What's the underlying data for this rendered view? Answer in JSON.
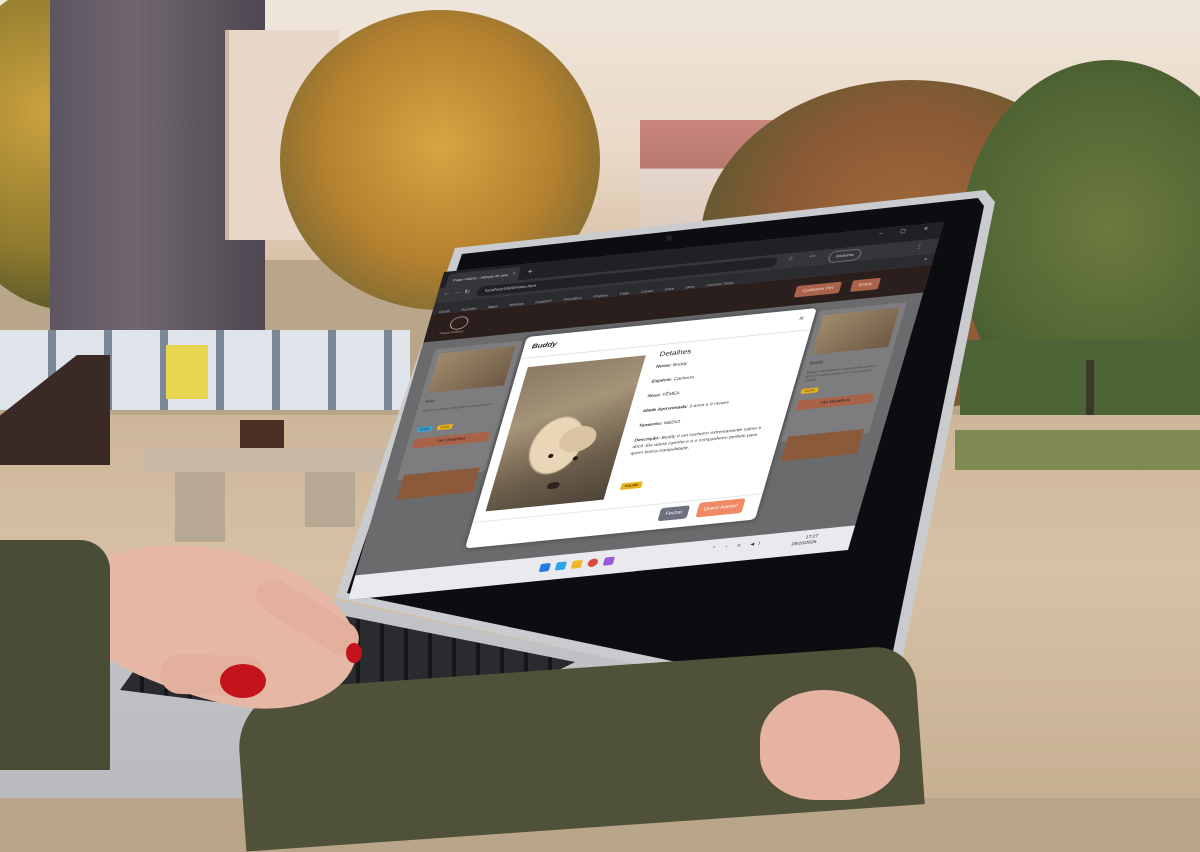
{
  "browser": {
    "tab_title": "Patas Felizes - Adoção de pets",
    "url": "localhost:5500/index.html",
    "profile_label": "Anônima",
    "bookmarks": [
      "Gmail",
      "YouTube",
      "Maps",
      "Notícias",
      "ChatGPT",
      "Pomodoro",
      "Projetos",
      "Trello",
      "Cursos",
      "Drive",
      "Docs",
      "Common Tasks"
    ]
  },
  "site": {
    "name": "Patas Felizes",
    "header_button_1": "Cadastrar Pet",
    "header_button_2": "Entrar"
  },
  "cards": [
    {
      "title": "Kiko",
      "text": "Kiko é um filhote brincalhão e adora passear.",
      "tags": [
        "ATIVO",
        "DÓCIL"
      ],
      "button": "Ver Detalhes"
    },
    {
      "title": "Buddy",
      "text": "Buddy é um cachorro extremamente calmo e dócil. Ele adora carinho e é o companheiro perfeito.",
      "tags": [
        "CALMO"
      ],
      "button": "Ver Detalhes"
    }
  ],
  "modal": {
    "title": "Buddy",
    "details_heading": "Detalhes",
    "fields": [
      {
        "label": "Nome:",
        "value": "Buddy"
      },
      {
        "label": "Espécie:",
        "value": "Cachorro"
      },
      {
        "label": "Sexo:",
        "value": "FÊMEA"
      },
      {
        "label": "Idade Aproximada:",
        "value": "3 anos e 9 meses"
      },
      {
        "label": "Tamanho:",
        "value": "MÉDIO"
      },
      {
        "label": "Descrição:",
        "value": "Buddy é um cachorro extremamente calmo e dócil. Ele adora carinho e é o companheiro perfeito para quem busca tranquilidade."
      }
    ],
    "tag": "CALMO",
    "close_button": "Fechar",
    "adopt_button": "Quero Adotar!"
  },
  "taskbar": {
    "time": "17:27",
    "date": "28/10/2025"
  },
  "colors": {
    "accent": "#ef8a64",
    "secondary_button": "#6c7180",
    "tag_yellow": "#e8b21a",
    "header_dark": "#2a1f1d"
  }
}
